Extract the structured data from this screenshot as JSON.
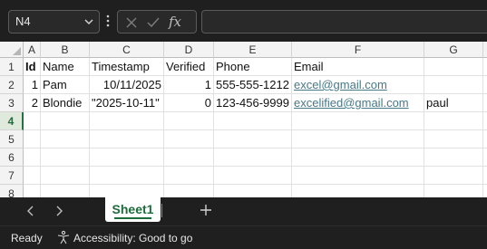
{
  "name_box": {
    "value": "N4"
  },
  "formula_bar": {
    "fx_label": "fx",
    "content": ""
  },
  "columns": [
    "A",
    "B",
    "C",
    "D",
    "E",
    "F",
    "G"
  ],
  "rows": [
    "1",
    "2",
    "3",
    "4",
    "5",
    "6",
    "7",
    "8"
  ],
  "selected_cell": "N4",
  "cells": {
    "A1": "Id",
    "B1": "Name",
    "C1": "Timestamp",
    "D1": "Verified",
    "E1": "Phone",
    "F1": "Email",
    "A2": "1",
    "B2": "Pam",
    "C2": "10/11/2025",
    "D2": "1",
    "E2": "555-555-1212",
    "F2": "excel@gmail.com",
    "A3": "2",
    "B3": "Blondie",
    "C3": "\"2025-10-11\"",
    "D3": "0",
    "E3": "123-456-9999",
    "F3": "excelified@gmail.com",
    "G3": "paul"
  },
  "sheet_tabs": [
    {
      "label": "Sheet1",
      "active": true
    }
  ],
  "status": {
    "mode": "Ready",
    "accessibility": "Accessibility: Good to go"
  },
  "colors": {
    "accent": "#217346",
    "link": "#467886",
    "chrome_bg": "#1f1f1f"
  }
}
